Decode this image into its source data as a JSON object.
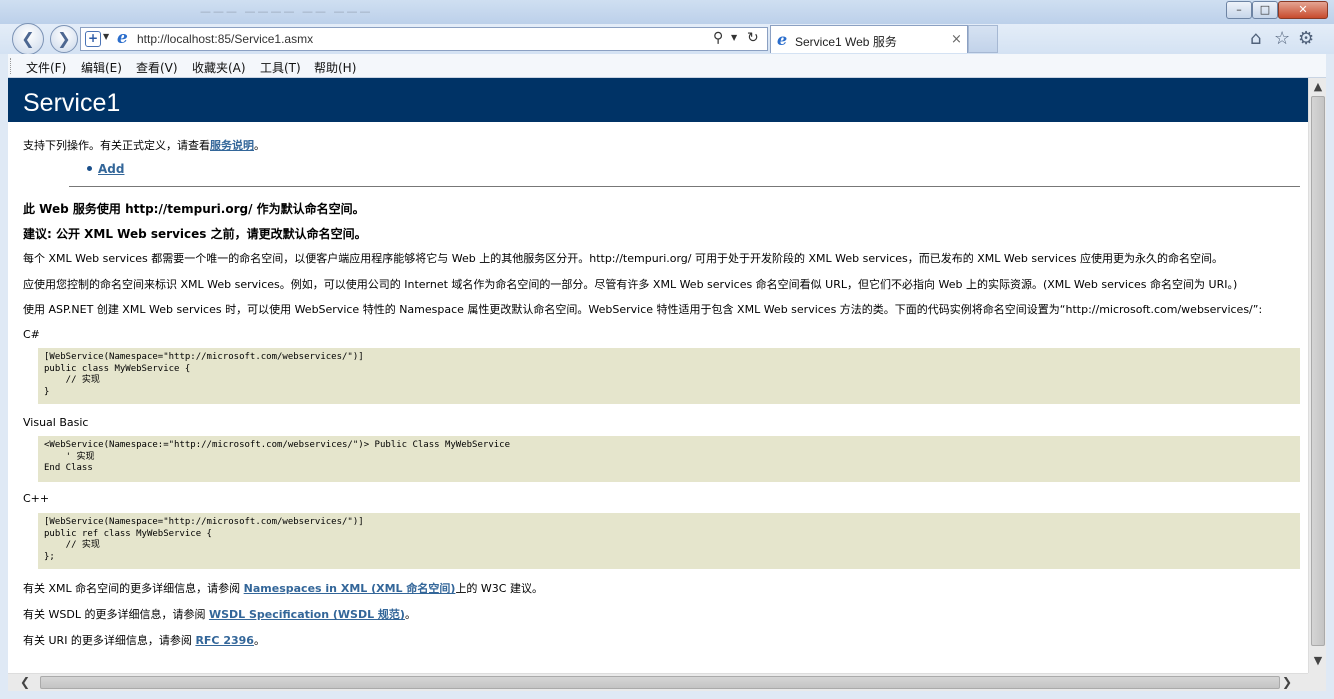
{
  "window": {
    "titlebar_ghost_text": "——— ————  ——  ———",
    "controls": {
      "minimize": "–",
      "maximize": "□",
      "close": "✕"
    }
  },
  "toolbar": {
    "back_icon": "back-arrow-icon",
    "forward_icon": "forward-arrow-icon",
    "address": "http://localhost:85/Service1.asmx",
    "tab_title": "Service1 Web 服务",
    "tab_close": "×",
    "icons": [
      "home-icon",
      "favorites-star-icon",
      "gear-icon"
    ]
  },
  "menubar": {
    "items": [
      "文件(F)",
      "编辑(E)",
      "查看(V)",
      "收藏夹(A)",
      "工具(T)",
      "帮助(H)"
    ]
  },
  "page": {
    "heading": "Service1",
    "intro_prefix": "支持下列操作。有关正式定义，请查看",
    "intro_link": "服务说明",
    "intro_suffix": "。",
    "operations": [
      "Add"
    ],
    "namespace_heading": "此 Web 服务使用 http://tempuri.org/ 作为默认命名空间。",
    "recommendation_heading": "建议: 公开 XML Web services 之前，请更改默认命名空间。",
    "para1": "每个 XML Web services 都需要一个唯一的命名空间，以便客户端应用程序能够将它与 Web 上的其他服务区分开。http://tempuri.org/ 可用于处于开发阶段的 XML Web services，而已发布的 XML Web services 应使用更为永久的命名空间。",
    "para2": "应使用您控制的命名空间来标识 XML Web services。例如，可以使用公司的 Internet 域名作为命名空间的一部分。尽管有许多 XML Web services 命名空间看似 URL，但它们不必指向 Web 上的实际资源。(XML Web services 命名空间为 URI。)",
    "para3": "使用 ASP.NET 创建 XML Web services 时，可以使用 WebService 特性的 Namespace 属性更改默认命名空间。WebService 特性适用于包含 XML Web services 方法的类。下面的代码实例将命名空间设置为“http://microsoft.com/webservices/”:",
    "code_samples": [
      {
        "language": "C#",
        "code": "[WebService(Namespace=\"http://microsoft.com/webservices/\")]\npublic class MyWebService {\n    // 实现\n}"
      },
      {
        "language": "Visual Basic",
        "code": "<WebService(Namespace:=\"http://microsoft.com/webservices/\")> Public Class MyWebService\n    ' 实现\nEnd Class"
      },
      {
        "language": "C++",
        "code": "[WebService(Namespace=\"http://microsoft.com/webservices/\")]\npublic ref class MyWebService {\n    // 实现\n};"
      }
    ],
    "footer1_prefix": "有关 XML 命名空间的更多详细信息，请参阅 ",
    "footer1_link": "Namespaces in XML (XML 命名空间)",
    "footer1_suffix": "上的 W3C 建议。",
    "footer2_prefix": "有关 WSDL 的更多详细信息，请参阅 ",
    "footer2_link": "WSDL Specification (WSDL 规范)",
    "footer2_suffix": "。",
    "footer3_prefix": "有关 URI 的更多详细信息，请参阅 ",
    "footer3_link": "RFC 2396",
    "footer3_suffix": "。"
  },
  "colors": {
    "heading_bg": "#003366",
    "link": "#336699",
    "code_bg": "#e5e5cc"
  }
}
